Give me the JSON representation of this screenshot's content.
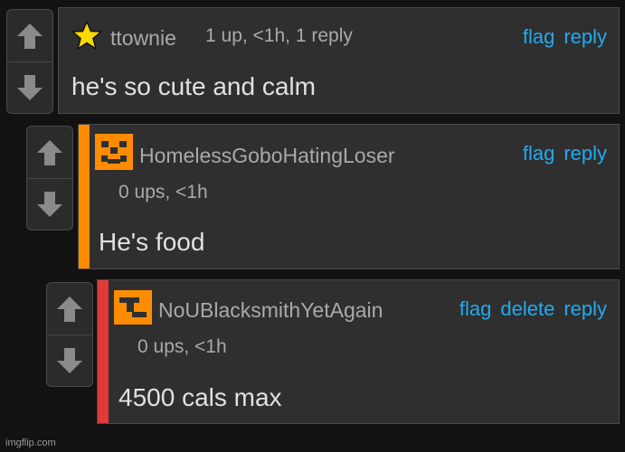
{
  "comments": [
    {
      "username": "ttownie",
      "meta": "1 up, <1h, 1 reply",
      "text": "he's so cute and calm",
      "actions": {
        "flag": "flag",
        "reply": "reply"
      },
      "avatar": "star-icon"
    },
    {
      "username": "HomelessGoboHatingLoser",
      "meta": "0 ups, <1h",
      "text": "He's food",
      "actions": {
        "flag": "flag",
        "reply": "reply"
      },
      "bar_color": "#ff8c00",
      "avatar": "pixel-face-avatar"
    },
    {
      "username": "NoUBlacksmithYetAgain",
      "meta": "0 ups, <1h",
      "text": "4500 cals max",
      "actions": {
        "flag": "flag",
        "delete": "delete",
        "reply": "reply"
      },
      "bar_color": "#e03a3a",
      "avatar": "pixel-logo-avatar"
    }
  ],
  "watermark": "imgflip.com",
  "colors": {
    "link": "#22aaf0",
    "background": "#121212",
    "panel": "#2f2f2f"
  }
}
